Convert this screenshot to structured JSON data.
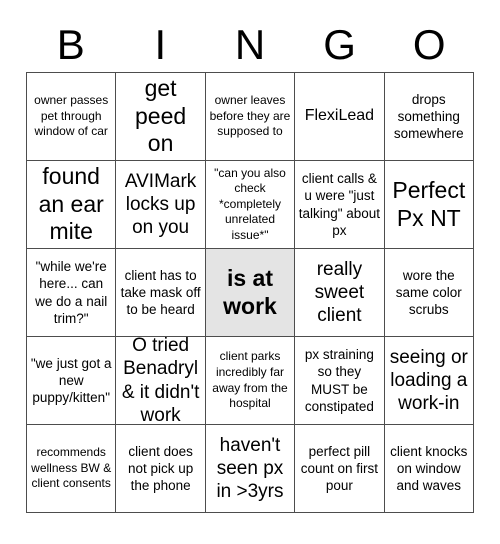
{
  "card": {
    "title": "BINGO",
    "header_letters": [
      "B",
      "I",
      "N",
      "G",
      "O"
    ],
    "grid_size": 5,
    "colors": {
      "background": "#ffffff",
      "text": "#000000",
      "grid_line": "#4d4d4d",
      "marked_cell": "#e4e4e4"
    },
    "rows": [
      [
        {
          "text": "owner passes pet through window of car",
          "size": "t-sm",
          "marked": false
        },
        {
          "text": "get peed on",
          "size": "t-xxl",
          "marked": false
        },
        {
          "text": "owner leaves before they are supposed to",
          "size": "t-sm",
          "marked": false
        },
        {
          "text": "FlexiLead",
          "size": "t-lg",
          "marked": false
        },
        {
          "text": "drops something somewhere",
          "size": "t-md",
          "marked": false
        }
      ],
      [
        {
          "text": "found an ear mite",
          "size": "t-xxl",
          "marked": false
        },
        {
          "text": "AVIMark locks up on you",
          "size": "t-xl",
          "marked": false
        },
        {
          "text": "\"can you also check *completely unrelated issue*\"",
          "size": "t-sm",
          "marked": false
        },
        {
          "text": "client calls & u were \"just talking\" about px",
          "size": "t-md",
          "marked": false
        },
        {
          "text": "Perfect Px NT",
          "size": "t-xxl",
          "marked": false
        }
      ],
      [
        {
          "text": "\"while we're here... can we do a nail trim?\"",
          "size": "t-md",
          "marked": false
        },
        {
          "text": "client has to take mask off to be heard",
          "size": "t-md",
          "marked": false
        },
        {
          "text": "is at work",
          "size": "t-xxl",
          "marked": true
        },
        {
          "text": "really sweet client",
          "size": "t-xl",
          "marked": false
        },
        {
          "text": "wore the same color scrubs",
          "size": "t-md",
          "marked": false
        }
      ],
      [
        {
          "text": "\"we just got a new puppy/kitten\"",
          "size": "t-md",
          "marked": false
        },
        {
          "text": "O tried Benadryl & it didn't work",
          "size": "t-xl",
          "marked": false
        },
        {
          "text": "client parks incredibly far away from the hospital",
          "size": "t-sm",
          "marked": false
        },
        {
          "text": "px straining so they MUST be constipated",
          "size": "t-md",
          "marked": false
        },
        {
          "text": "seeing or loading a work-in",
          "size": "t-xl",
          "marked": false
        }
      ],
      [
        {
          "text": "recommends wellness BW & client consents",
          "size": "t-sm",
          "marked": false
        },
        {
          "text": "client does not pick up the phone",
          "size": "t-md",
          "marked": false
        },
        {
          "text": "haven't seen px in >3yrs",
          "size": "t-xl",
          "marked": false
        },
        {
          "text": "perfect pill count on first pour",
          "size": "t-md",
          "marked": false
        },
        {
          "text": "client knocks on window and waves",
          "size": "t-md",
          "marked": false
        }
      ]
    ]
  }
}
